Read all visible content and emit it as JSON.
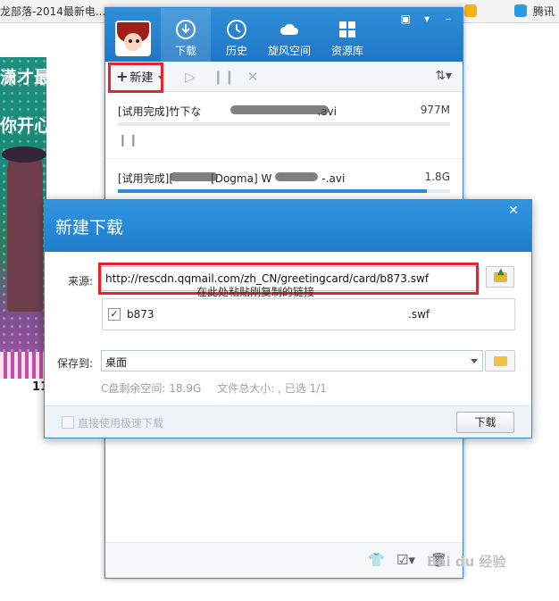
{
  "browser": {
    "tabs": [
      {
        "label": "龙部落-2014最新电..."
      },
      {
        "label": "腾讯"
      },
      {
        "label": "腾讯"
      }
    ],
    "caption": "11"
  },
  "background": {
    "banner_text_1": "潇才最珍贵,",
    "banner_text_2": "你开心每一天"
  },
  "downloader": {
    "nav_tabs": [
      {
        "label": "下载",
        "icon": "download-icon"
      },
      {
        "label": "历史",
        "icon": "history-icon"
      },
      {
        "label": "旋风空间",
        "icon": "cloud-icon"
      },
      {
        "label": "资源库",
        "icon": "resource-icon"
      }
    ],
    "toolbar": {
      "new_label": "新建"
    },
    "tasks": [
      {
        "name": "[试用完成]竹下な",
        "name_suffix": ".avi",
        "size": "977M",
        "progress": 0.0
      },
      {
        "name": "[试用完成][",
        "name_suffix": "[Dogma] W",
        "name_end": "-.avi",
        "size": "1.8G",
        "progress": 0.93
      }
    ]
  },
  "dialog": {
    "title": "新建下载",
    "source_label": "来源:",
    "url": "http://rescdn.qqmail.com/zh_CN/greetingcard/card/b873.swf",
    "annotation": "在此处粘贴刚复制的链接",
    "file": {
      "name": "b873",
      "ext": ".swf",
      "checked": true
    },
    "save_label": "保存到:",
    "save_location": "桌面",
    "space_free": "C盘剩余空间: 18.9G",
    "total_size": "文件总大小: , 已选 1/1",
    "fast_download_label": "直接使用极速下载",
    "download_button": "下载"
  },
  "watermark": "Bai du 经验",
  "colors": {
    "accent": "#1f7dcc",
    "highlight": "#e8232d",
    "progress": "#2b8ce0"
  }
}
